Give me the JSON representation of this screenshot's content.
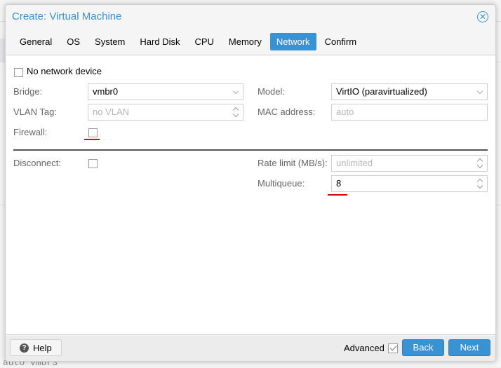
{
  "window": {
    "title": "Create: Virtual Machine",
    "close_icon": "close-circle-icon"
  },
  "tabs": [
    {
      "label": "General",
      "active": false
    },
    {
      "label": "OS",
      "active": false
    },
    {
      "label": "System",
      "active": false
    },
    {
      "label": "Hard Disk",
      "active": false
    },
    {
      "label": "CPU",
      "active": false
    },
    {
      "label": "Memory",
      "active": false
    },
    {
      "label": "Network",
      "active": true
    },
    {
      "label": "Confirm",
      "active": false
    }
  ],
  "form": {
    "no_network_device": {
      "label": "No network device",
      "checked": false
    },
    "bridge": {
      "label": "Bridge:",
      "value": "vmbr0"
    },
    "vlan_tag": {
      "label": "VLAN Tag:",
      "placeholder": "no VLAN"
    },
    "firewall": {
      "label": "Firewall:",
      "checked": false
    },
    "model": {
      "label": "Model:",
      "value": "VirtIO (paravirtualized)"
    },
    "mac_address": {
      "label": "MAC address:",
      "placeholder": "auto"
    },
    "disconnect": {
      "label": "Disconnect:",
      "checked": false
    },
    "rate_limit": {
      "label": "Rate limit (MB/s):",
      "placeholder": "unlimited"
    },
    "multiqueue": {
      "label": "Multiqueue:",
      "value": "8"
    }
  },
  "footer": {
    "help_label": "Help",
    "advanced_label": "Advanced",
    "advanced_checked": true,
    "back_label": "Back",
    "next_label": "Next"
  },
  "background": {
    "text_bottom": "auto vmbr3"
  },
  "colors": {
    "accent": "#3892d4",
    "highlight_underline": "#e00000"
  }
}
